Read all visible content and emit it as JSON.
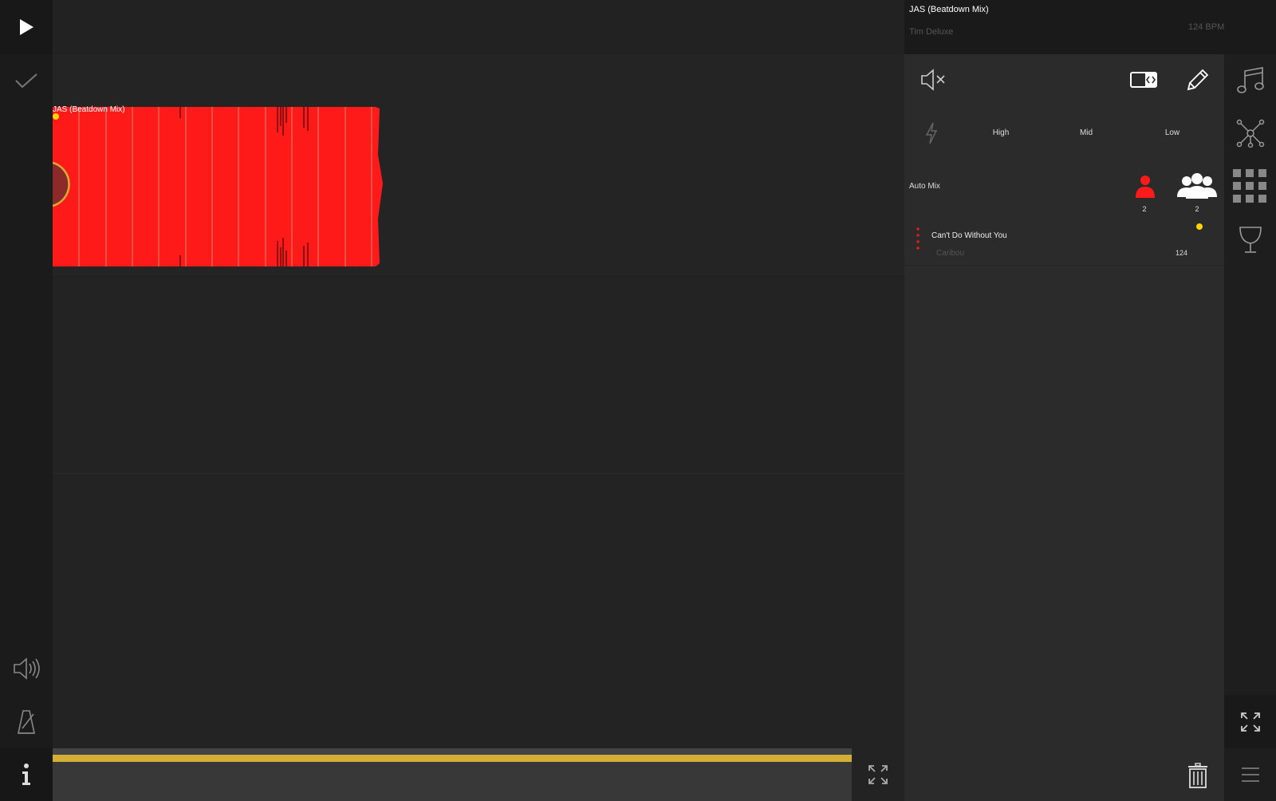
{
  "colors": {
    "accent_red": "#ff1a1a",
    "accent_yellow": "#d4af37",
    "dot_yellow": "#ffd400",
    "panel_bg": "#2b2b2b",
    "rail_bg": "#1b1b1b"
  },
  "left_rail": {
    "icons": [
      "play-icon",
      "checkmark-icon",
      "speaker-icon",
      "metronome-icon",
      "info-icon"
    ]
  },
  "track": {
    "title": "JAS (Beatdown Mix)"
  },
  "timeline": {
    "progress_fraction": 1.0
  },
  "now_playing": {
    "title": "JAS (Beatdown Mix)",
    "artist": "Tim Deluxe",
    "bpm": "124 BPM"
  },
  "controls": {
    "icons": [
      "mute-icon",
      "loop-edit-icon",
      "pencil-icon",
      "lightning-icon"
    ],
    "eq": {
      "high": "High",
      "mid": "Mid",
      "low": "Low"
    }
  },
  "auto_mix": {
    "label": "Auto Mix",
    "single_count": "2",
    "group_count": "2"
  },
  "queue": [
    {
      "title": "Can't Do Without You",
      "artist": "Caribou",
      "bpm": "124"
    }
  ],
  "right_rail": {
    "icons": [
      "music-note-icon",
      "network-icon",
      "grid-icon",
      "trophy-icon",
      "expand-icon",
      "menu-icon"
    ]
  }
}
